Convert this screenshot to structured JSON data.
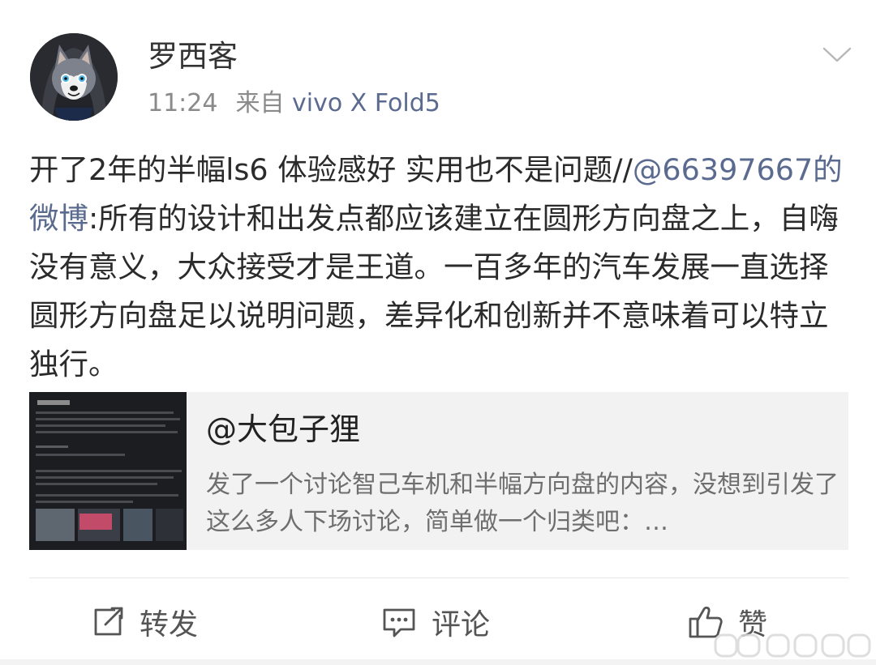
{
  "post": {
    "username": "罗西客",
    "time": "11:24",
    "source_prefix": "来自",
    "source_device": "vivo X Fold5",
    "text_before": "开了2年的半幅ls6 体验感好 实用也不是问题//",
    "mention": "@66397667的微博",
    "text_after": ":所有的设计和出发点都应该建立在圆形方向盘之上，自嗨没有意义，大众接受才是王道。一百多年的汽车发展一直选择圆形方向盘足以说明问题，差异化和创新并不意味着可以特立独行。"
  },
  "card": {
    "title": "@大包子狸",
    "description": "发了一个讨论智己车机和半幅方向盘的内容，没想到引发了这么多人下场讨论，简单做一个归类吧：…"
  },
  "actions": {
    "repost_label": "转发",
    "comment_label": "评论",
    "like_label": "赞"
  },
  "icons": {
    "menu": "chevron-down-icon",
    "repost": "share-out-icon",
    "comment": "comment-bubble-icon",
    "like": "thumbs-up-icon"
  },
  "colors": {
    "text": "#2b2b2b",
    "mention": "#5b6b8f",
    "meta": "#8a8a8a",
    "card_bg": "#f2f2f2"
  }
}
